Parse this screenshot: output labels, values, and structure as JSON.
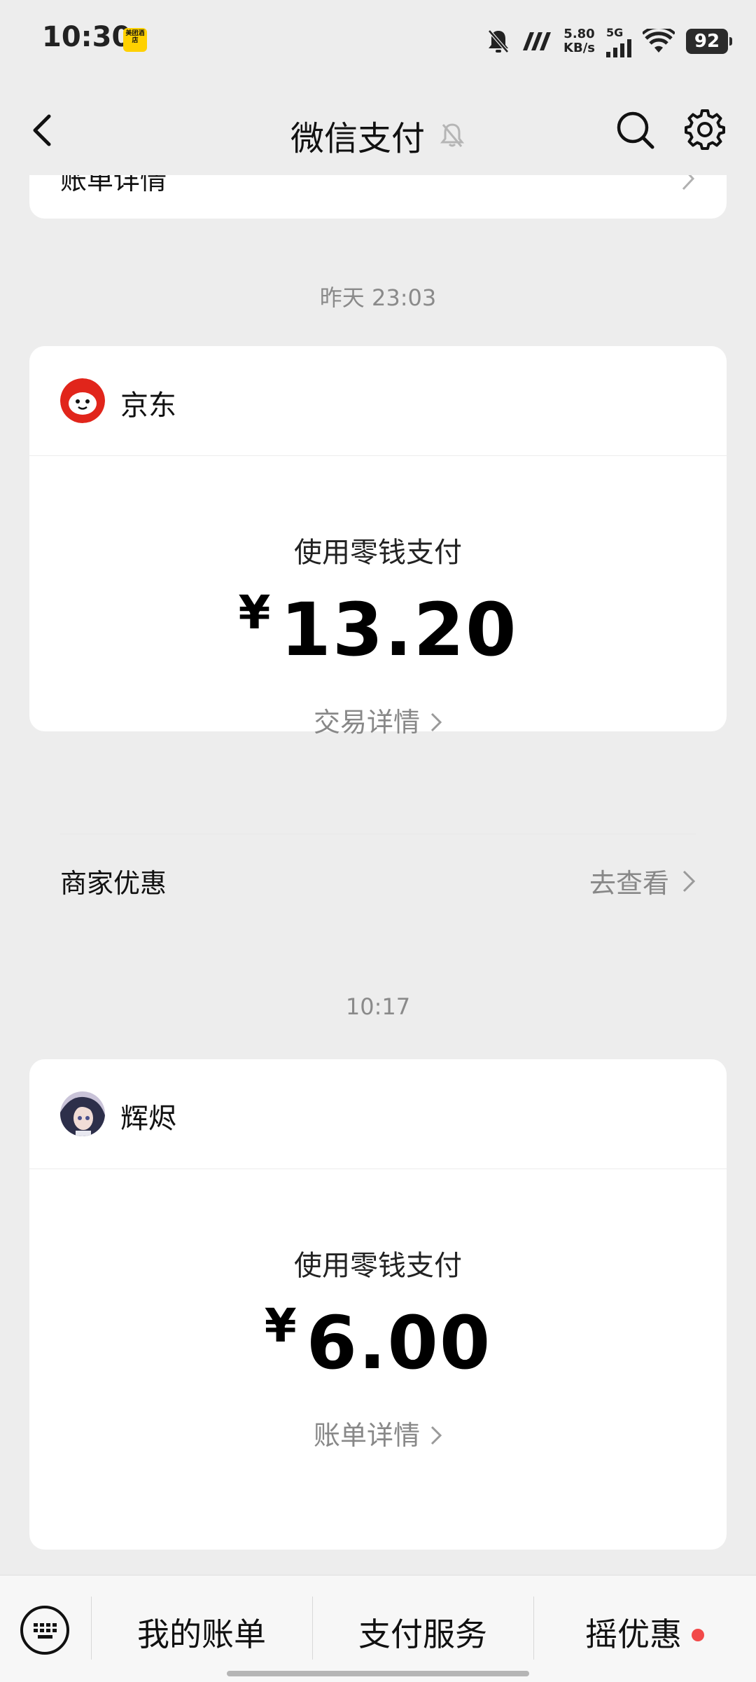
{
  "status_bar": {
    "time": "10:30",
    "app_badge_text": "美团酒店",
    "net_speed_value": "5.80",
    "net_speed_unit": "KB/s",
    "signal_label": "5G",
    "battery": "92"
  },
  "nav": {
    "title": "微信支付"
  },
  "partial_card": {
    "label": "账单详情"
  },
  "transactions": [
    {
      "timestamp": "昨天 23:03",
      "merchant": "京东",
      "pay_method": "使用零钱支付",
      "currency": "¥",
      "amount": "13.20",
      "detail_link": "交易详情",
      "promo_label": "商家优惠",
      "promo_action": "去查看"
    },
    {
      "timestamp": "10:17",
      "merchant": "辉烬",
      "pay_method": "使用零钱支付",
      "currency": "¥",
      "amount": "6.00",
      "detail_link": "账单详情"
    }
  ],
  "bottom_bar": {
    "items": [
      "我的账单",
      "支付服务",
      "摇优惠"
    ]
  },
  "colors": {
    "background": "#ededed",
    "card": "#ffffff",
    "muted_text": "#888888",
    "red_dot": "#f24a4a",
    "jd_red": "#e1251b"
  }
}
